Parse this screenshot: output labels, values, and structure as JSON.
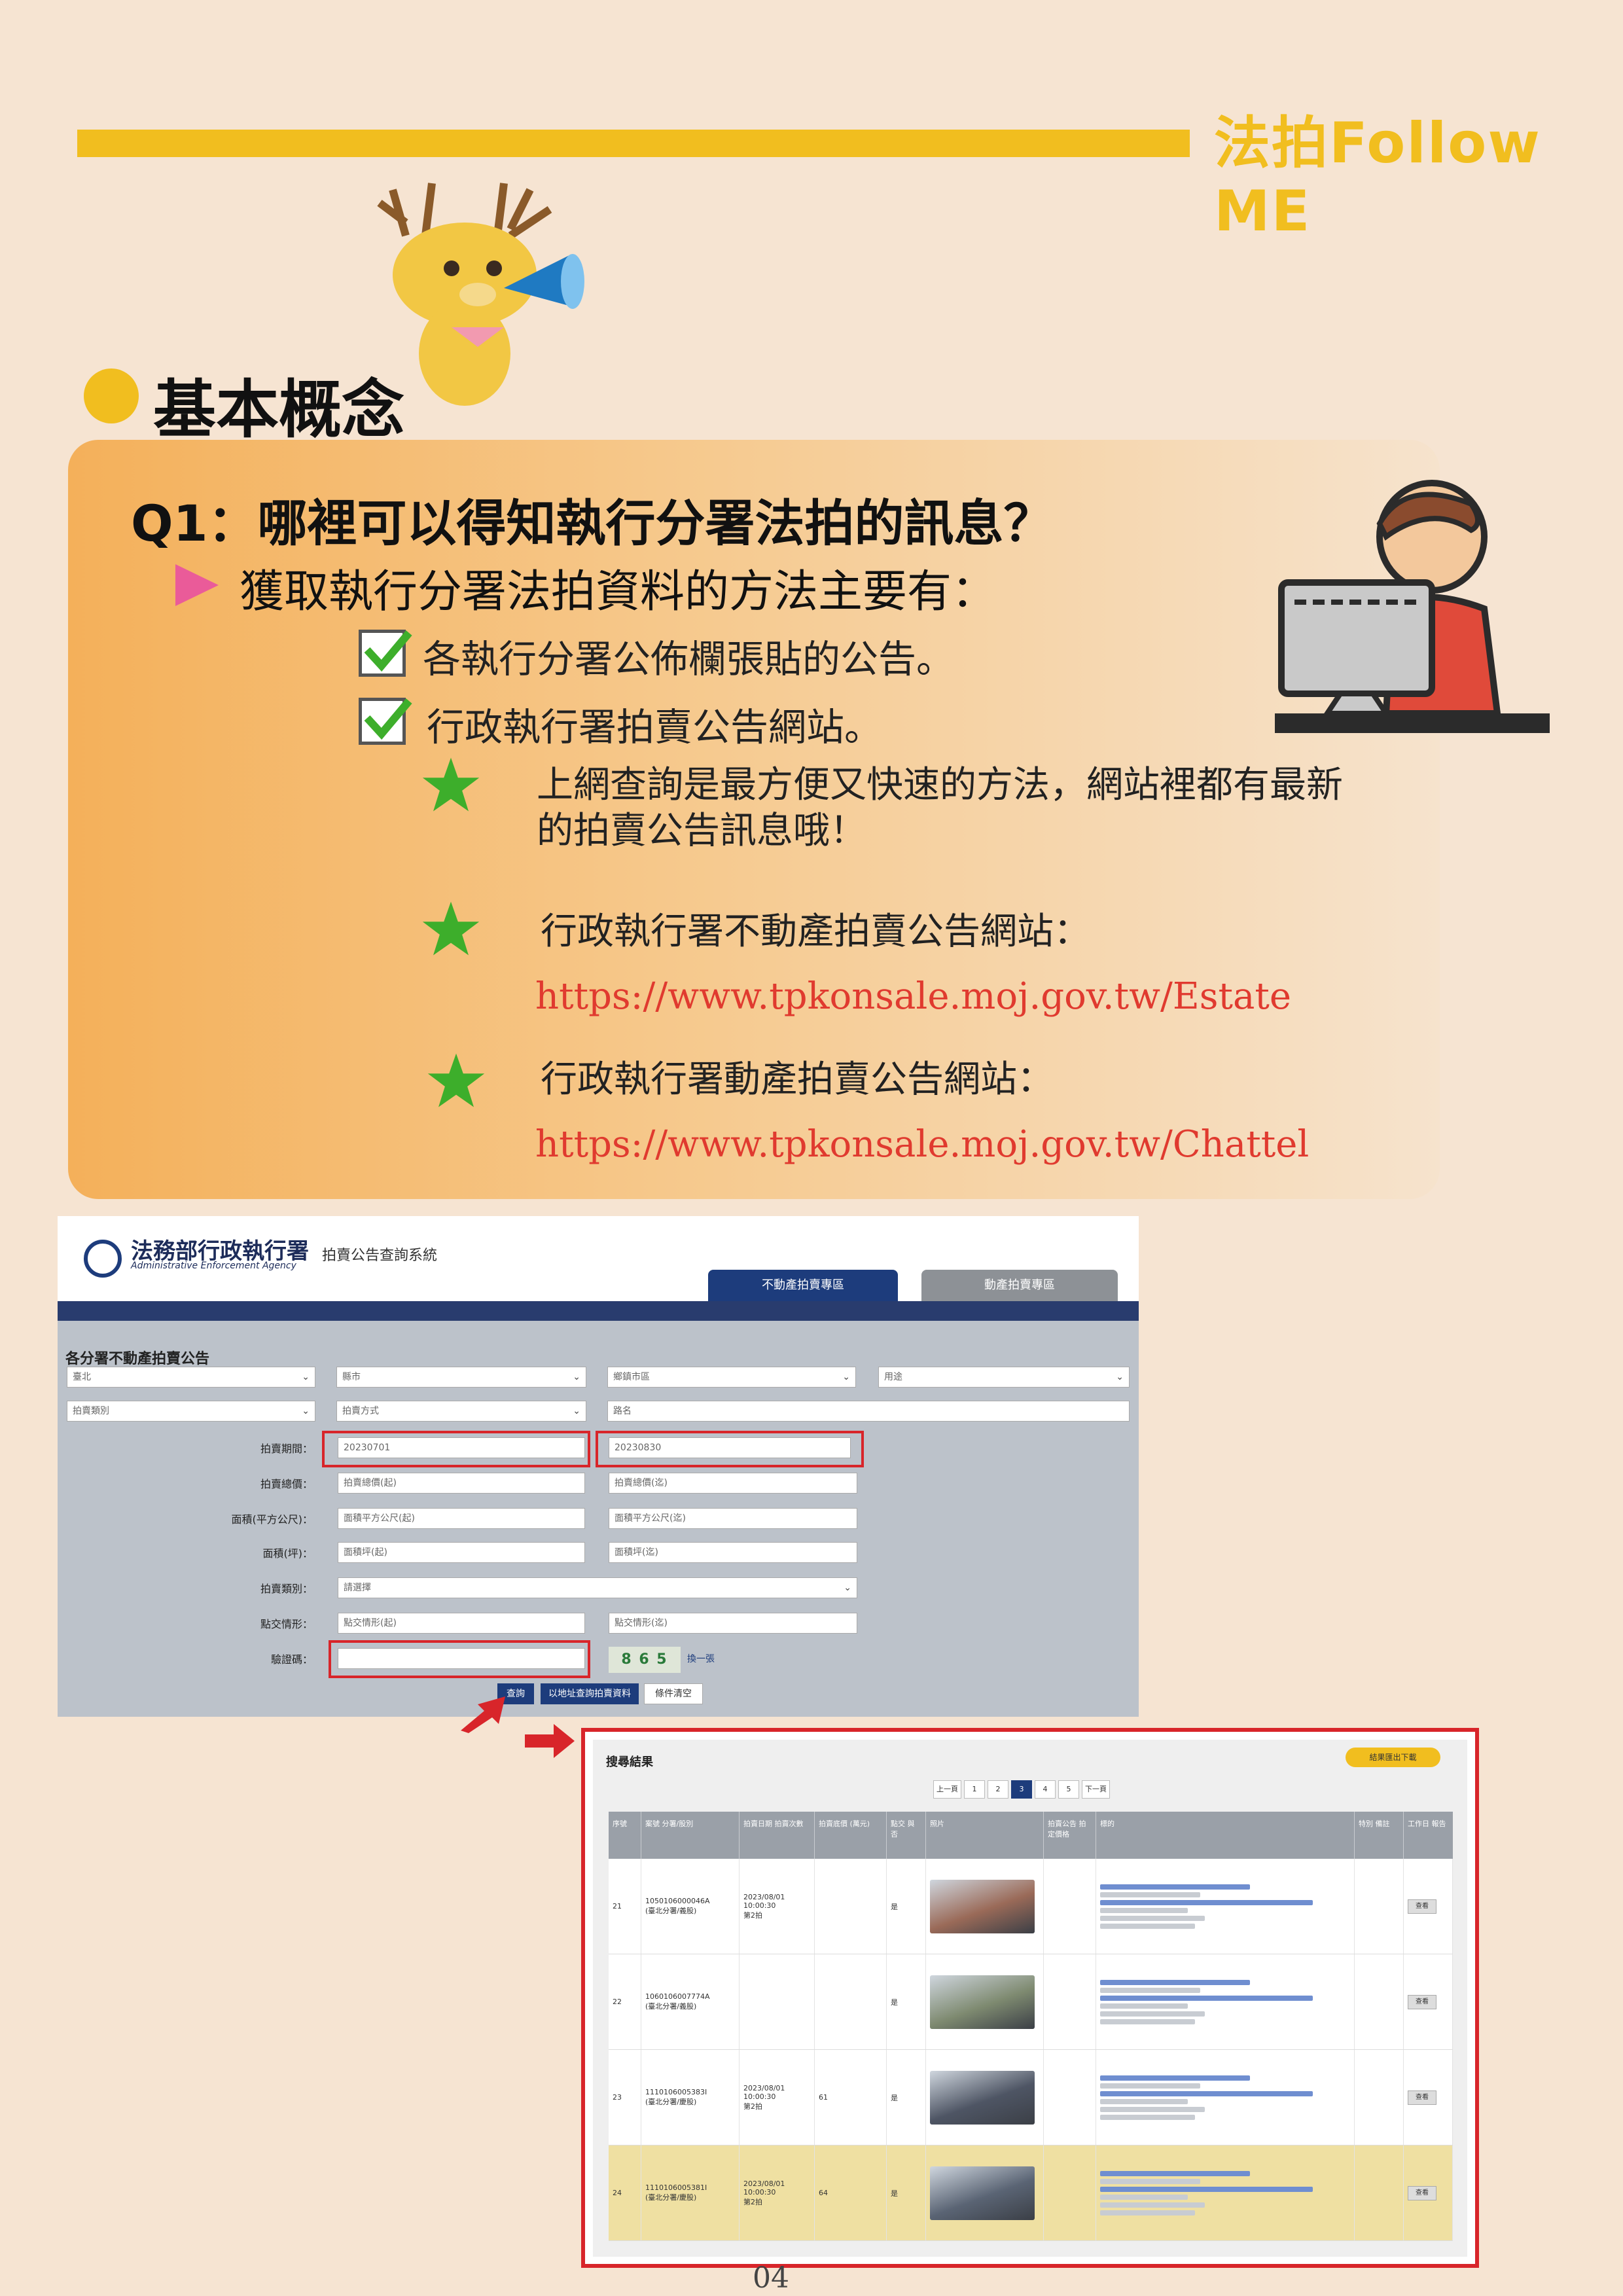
{
  "header": {
    "brand": "法拍Follow ME"
  },
  "section": {
    "title": "基本概念"
  },
  "question": {
    "title": "Q1：哪裡可以得知執行分署法拍的訊息？",
    "subtitle": "獲取執行分署法拍資料的方法主要有：",
    "checks": [
      "各執行分署公佈欄張貼的公告。",
      "行政執行署拍賣公告網站。"
    ],
    "tips": [
      {
        "lines": [
          "上網查詢是最方便又快速的方法，網站裡都有最新",
          "的拍賣公告訊息哦！"
        ],
        "link": ""
      },
      {
        "lines": [
          "行政執行署不動產拍賣公告網站："
        ],
        "link": "https://www.tpkonsale.moj.gov.tw/Estate"
      },
      {
        "lines": [
          "行政執行署動產拍賣公告網站："
        ],
        "link": "https://www.tpkonsale.moj.gov.tw/Chattel"
      }
    ]
  },
  "screenshot1": {
    "logo_title": "法務部行政執行署",
    "logo_subtitle": "Administrative Enforcement Agency",
    "logo_tag": "拍賣公告查詢系統",
    "tabs": [
      "不動產拍賣專區",
      "動產拍賣專區"
    ],
    "form_title": "各分署不動產拍賣公告",
    "row1_selects": [
      "臺北",
      "縣市",
      "鄉鎮市區",
      "用途"
    ],
    "row2_selects": [
      "拍賣類別",
      "拍賣方式"
    ],
    "row2_input": "路名",
    "labels": [
      "拍賣期間：",
      "拍賣總價：",
      "面積(平方公尺)：",
      "面積(坪)：",
      "拍賣類別：",
      "點交情形：",
      "驗證碼："
    ],
    "date_from": "20230701",
    "date_to": "20230830",
    "ranges": [
      [
        "拍賣總價(起)",
        "拍賣總價(迄)"
      ],
      [
        "面積平方公尺(起)",
        "面積平方公尺(迄)"
      ],
      [
        "面積坪(起)",
        "面積坪(迄)"
      ]
    ],
    "category_select": "請選擇",
    "handover": [
      "點交情形(起)",
      "點交情形(迄)"
    ],
    "captcha": "8 6 5",
    "captcha_refresh": "換一張",
    "buttons": [
      "查詢",
      "以地址查詢拍賣資料",
      "條件清空"
    ]
  },
  "screenshot2": {
    "title": "搜尋結果",
    "download": "結果匯出下載",
    "pager": [
      "上一頁",
      "1",
      "2",
      "3",
      "4",
      "5",
      "下一頁"
    ],
    "current_page": "3",
    "headers": [
      "序號",
      "案號 分署/股別",
      "拍賣日期 拍賣次數",
      "拍賣底價 (萬元)",
      "點交 與否",
      "照片",
      "拍賣公告 拍定價格",
      "標的",
      "特別 備註",
      "工作日 報告"
    ],
    "rows": [
      {
        "no": "21",
        "case": "1050106000046A",
        "unit": "(臺北分署/義股)",
        "date": "2023/08/01",
        "time": "10:00:30",
        "round": "第2拍",
        "price": "",
        "handover": "是",
        "thumb": "#9a6a58"
      },
      {
        "no": "22",
        "case": "1060106007774A",
        "unit": "(臺北分署/義股)",
        "date": "",
        "time": "",
        "round": "",
        "price": "",
        "handover": "是",
        "thumb": "#7e8a70"
      },
      {
        "no": "23",
        "case": "1110106005383I",
        "unit": "(臺北分署/慶股)",
        "date": "2023/08/01",
        "time": "10:00:30",
        "round": "第2拍",
        "price": "61",
        "handover": "是",
        "thumb": "#4e5564"
      },
      {
        "no": "24",
        "case": "1110106005381I",
        "unit": "(臺北分署/慶股)",
        "date": "2023/08/01",
        "time": "10:00:30",
        "round": "第2拍",
        "price": "64",
        "handover": "是",
        "thumb": "#5a6474"
      }
    ],
    "view_label": "查看"
  },
  "page_number": "04",
  "colors": {
    "accent": "#f1be1f",
    "link": "#e03a2f",
    "highlight": "#d8252a",
    "navy": "#1d3c7c"
  }
}
